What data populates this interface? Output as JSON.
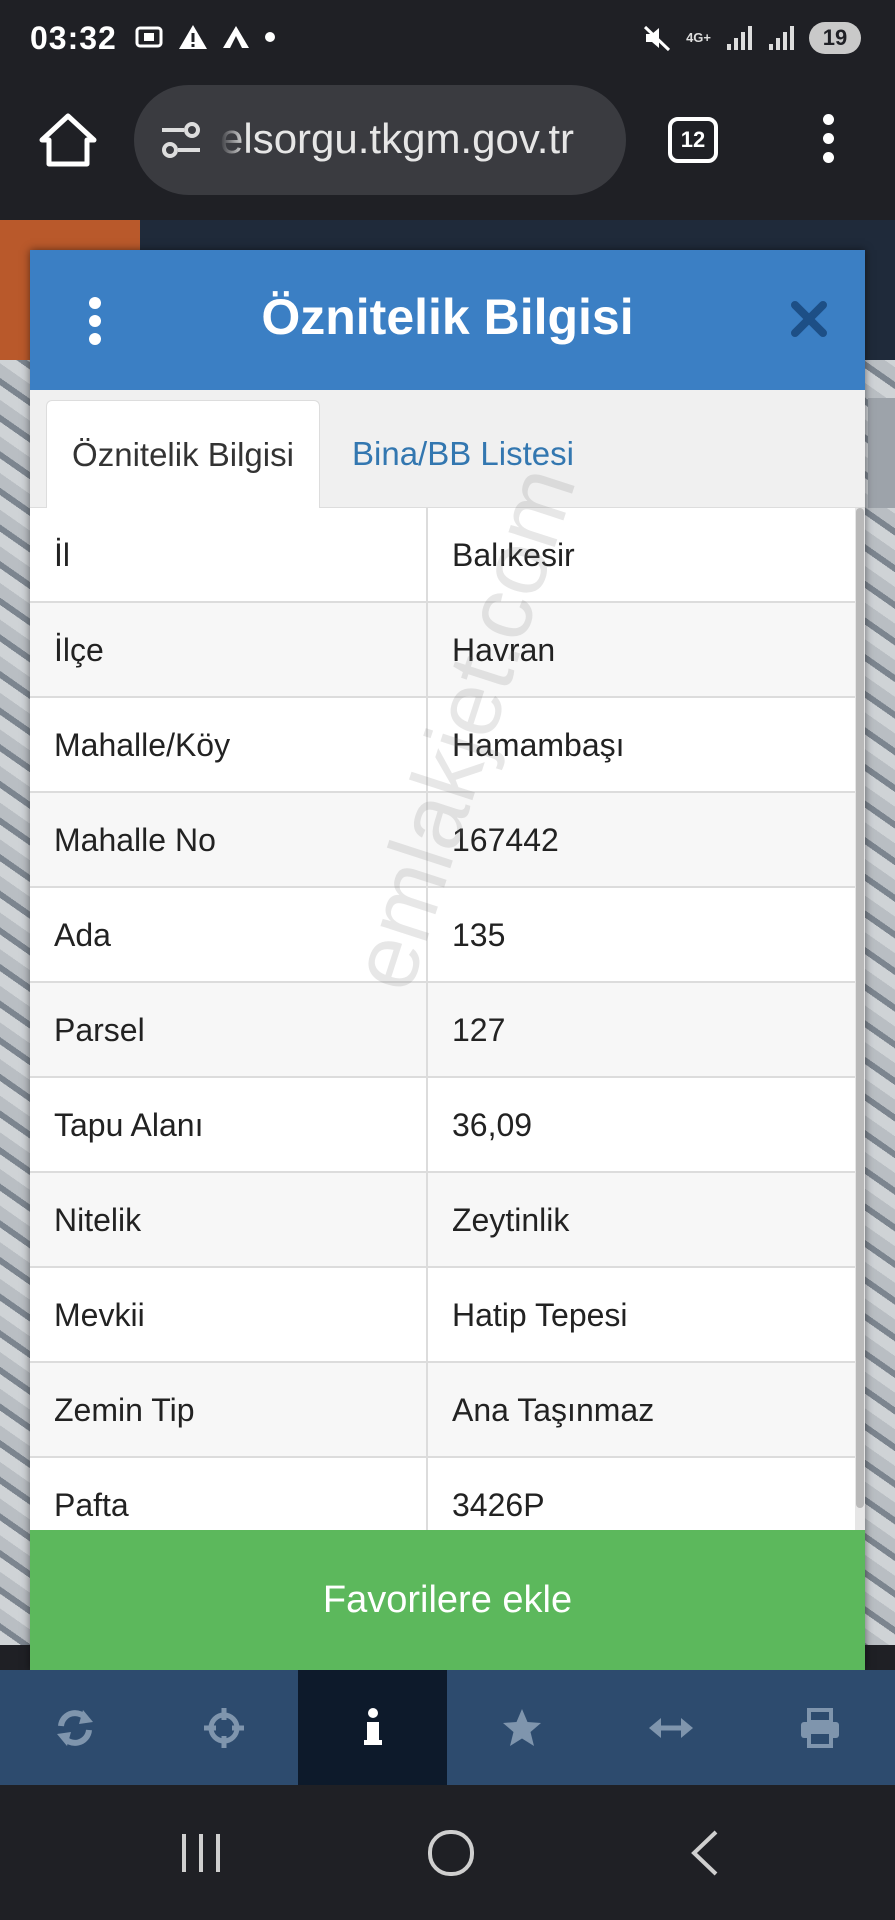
{
  "status_bar": {
    "time": "03:32",
    "network": "4G+",
    "battery": "19"
  },
  "browser": {
    "url": "elsorgu.tkgm.gov.tr",
    "tab_count": "12"
  },
  "modal": {
    "title": "Öznitelik Bilgisi",
    "tabs": [
      {
        "label": "Öznitelik Bilgisi"
      },
      {
        "label": "Bina/BB Listesi"
      }
    ],
    "rows": [
      {
        "label": "İl",
        "value": "Balıkesir"
      },
      {
        "label": "İlçe",
        "value": "Havran"
      },
      {
        "label": "Mahalle/Köy",
        "value": "Hamambaşı"
      },
      {
        "label": "Mahalle No",
        "value": "167442"
      },
      {
        "label": "Ada",
        "value": "135"
      },
      {
        "label": "Parsel",
        "value": "127"
      },
      {
        "label": "Tapu Alanı",
        "value": "36,09"
      },
      {
        "label": "Nitelik",
        "value": "Zeytinlik"
      },
      {
        "label": "Mevkii",
        "value": "Hatip Tepesi"
      },
      {
        "label": "Zemin Tip",
        "value": "Ana Taşınmaz"
      },
      {
        "label": "Pafta",
        "value": "3426P"
      }
    ],
    "favorite_button": "Favorilere ekle",
    "watermark": "emlakjet.com"
  },
  "app_nav": {
    "items": [
      {
        "icon": "refresh-icon"
      },
      {
        "icon": "crosshair-icon"
      },
      {
        "icon": "info-icon"
      },
      {
        "icon": "star-icon"
      },
      {
        "icon": "measure-icon"
      },
      {
        "icon": "print-icon"
      }
    ],
    "active_index": 2
  },
  "colors": {
    "header_blue": "#3b7fc4",
    "tab_link": "#3377b0",
    "favorite_green": "#5cb85c",
    "app_nav": "#2d4b6e"
  }
}
